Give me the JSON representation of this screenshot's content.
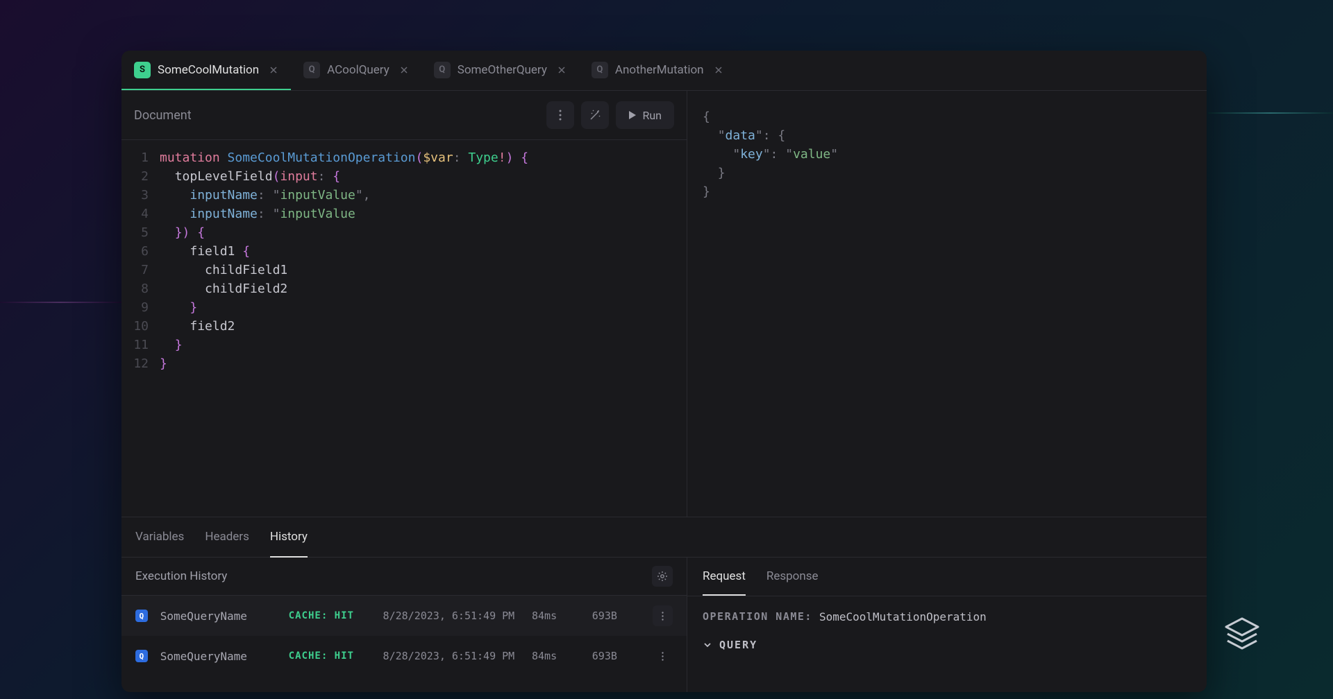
{
  "tabs": [
    {
      "badge": "S",
      "label": "SomeCoolMutation",
      "active": true
    },
    {
      "badge": "Q",
      "label": "ACoolQuery",
      "active": false
    },
    {
      "badge": "Q",
      "label": "SomeOtherQuery",
      "active": false
    },
    {
      "badge": "Q",
      "label": "AnotherMutation",
      "active": false
    }
  ],
  "toolbar": {
    "section_label": "Document",
    "run_label": "Run"
  },
  "code": {
    "lines": [
      "1",
      "2",
      "3",
      "4",
      "5",
      "6",
      "7",
      "8",
      "9",
      "10",
      "11",
      "12"
    ],
    "kw_mutation": "mutation",
    "op_name": "SomeCoolMutationOperation",
    "var": "$var",
    "type": "Type",
    "topfield": "topLevelField",
    "input_kw": "input",
    "input_name": "inputName",
    "input_value": "inputValue",
    "field1": "field1",
    "child1": "childField1",
    "child2": "childField2",
    "field2": "field2"
  },
  "response": {
    "data_key": "data",
    "key": "key",
    "value": "value"
  },
  "bottom_tabs": {
    "variables": "Variables",
    "headers": "Headers",
    "history": "History"
  },
  "history": {
    "title": "Execution History",
    "rows": [
      {
        "badge": "Q",
        "name": "SomeQueryName",
        "cache": "CACHE: HIT",
        "time": "8/28/2023, 6:51:49 PM",
        "dur": "84ms",
        "size": "693B"
      },
      {
        "badge": "Q",
        "name": "SomeQueryName",
        "cache": "CACHE: HIT",
        "time": "8/28/2023, 6:51:49 PM",
        "dur": "84ms",
        "size": "693B"
      }
    ]
  },
  "detail": {
    "tabs": {
      "request": "Request",
      "response": "Response"
    },
    "op_label": "OPERATION NAME:",
    "op_value": "SomeCoolMutationOperation",
    "query_label": "QUERY"
  }
}
